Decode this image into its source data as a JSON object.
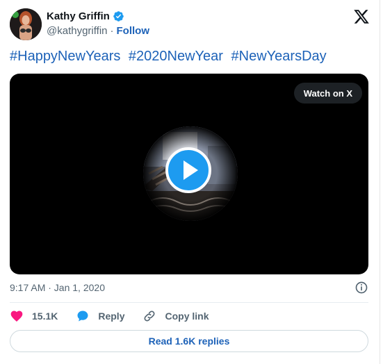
{
  "author": {
    "name": "Kathy Griffin",
    "handle": "@kathygriffin",
    "follow_label": "Follow"
  },
  "tweet": {
    "hashtags": [
      "#HappyNewYears",
      "#2020NewYear",
      "#NewYearsDay"
    ]
  },
  "video": {
    "watch_label": "Watch on X"
  },
  "meta": {
    "timestamp": "9:17 AM · Jan 1, 2020"
  },
  "actions": {
    "likes": "15.1K",
    "reply_label": "Reply",
    "copy_label": "Copy link"
  },
  "footer": {
    "read_replies_label": "Read 1.6K replies"
  },
  "icons": {
    "verified": "verified-badge-icon",
    "logo": "x-logo-icon",
    "play": "play-icon",
    "info": "info-icon",
    "like": "heart-icon",
    "reply": "reply-bubble-icon",
    "copy": "link-icon"
  },
  "colors": {
    "link_blue": "#1d62b8",
    "verified_blue": "#1d9bf0",
    "like_pink": "#f91880",
    "text": "#0f1419",
    "muted": "#536471"
  }
}
